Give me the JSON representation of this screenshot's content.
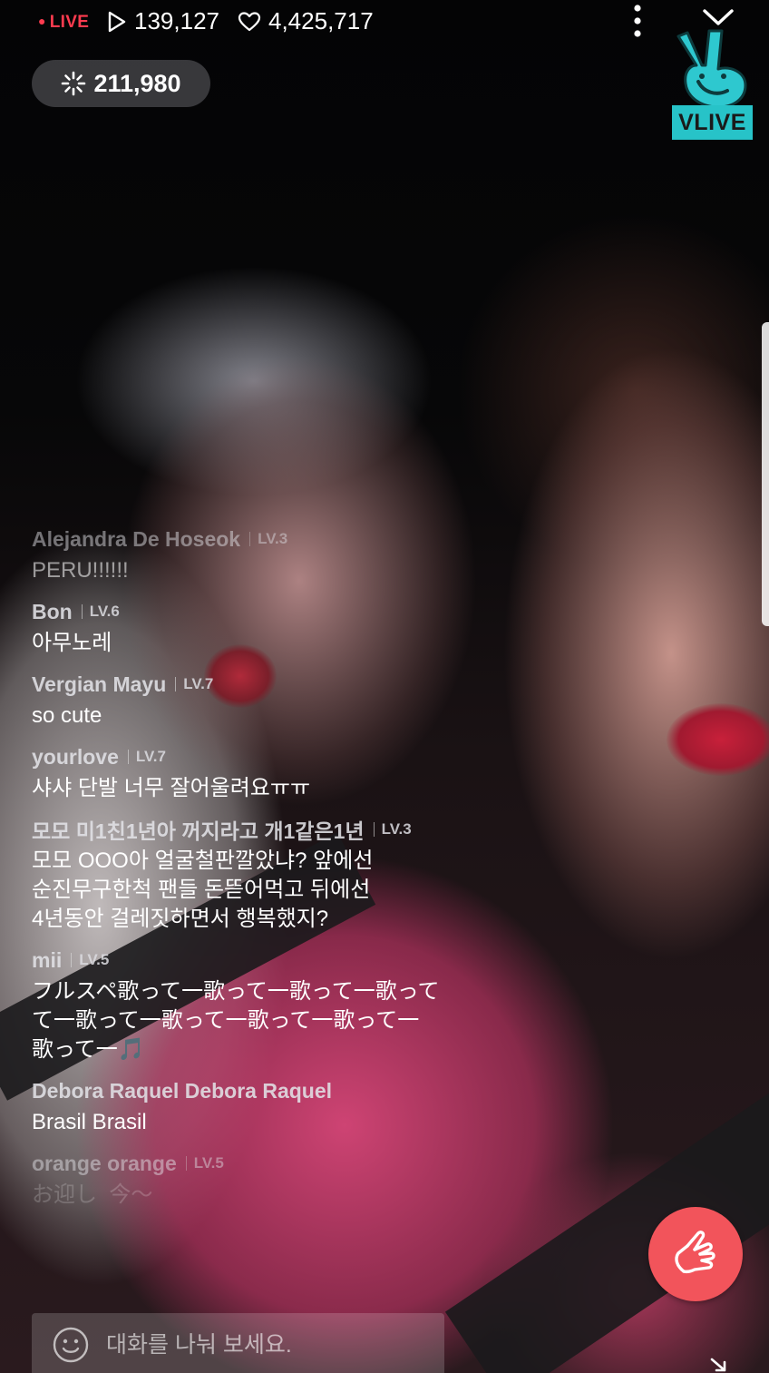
{
  "stream": {
    "live_label": "LIVE",
    "views": "139,127",
    "likes": "4,425,717",
    "hearts_count": "211,980",
    "brand_label": "VLIVE",
    "accent_color": "#27c3c8",
    "live_color": "#ff3b4f",
    "heart_button_color": "#f2545b"
  },
  "icons": {
    "views": "play-icon",
    "likes": "heart-outline-icon",
    "hearts": "sparkle-icon",
    "more": "more-vertical-icon",
    "close": "chevron-down-icon",
    "emoji": "smiley-icon",
    "heart_button": "finger-heart-icon"
  },
  "chat": {
    "messages": [
      {
        "user": "Alejandra De Hoseok",
        "level": "LV.3",
        "text": "PERU!!!!!!"
      },
      {
        "user": "Bon",
        "level": "LV.6",
        "text": "아무노레"
      },
      {
        "user": "Vergian Mayu",
        "level": "LV.7",
        "text": "so cute"
      },
      {
        "user": "yourlove",
        "level": "LV.7",
        "text": "샤샤 단발 너무 잘어울려요ㅠㅠ"
      },
      {
        "user": "모모 미1친1년아 꺼지라고 개1같은1년",
        "level": "LV.3",
        "text": "모모 OOO아 얼굴철판깔았냐? 앞에선\n순진무구한척 팬들 돈뜯어먹고 뒤에선\n4년동안 걸레짓하면서 행복했지?"
      },
      {
        "user": "mii",
        "level": "LV.5",
        "text": "フルスペ歌って一歌って一歌って一歌って\nて一歌って一歌って一歌って一歌って一\n歌って一🎵"
      },
      {
        "user": "Debora Raquel Debora Raquel",
        "level": "",
        "text": "Brasil Brasil"
      },
      {
        "user": "orange orange",
        "level": "LV.5",
        "text": "お迎し  今〜"
      }
    ]
  },
  "input": {
    "placeholder": "대화를 나눠 보세요."
  }
}
